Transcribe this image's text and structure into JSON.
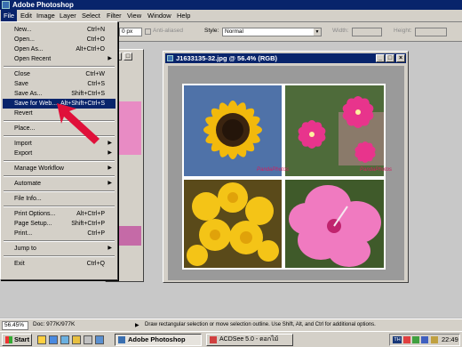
{
  "app": {
    "title": "Adobe Photoshop"
  },
  "menubar": [
    "File",
    "Edit",
    "Image",
    "Layer",
    "Select",
    "Filter",
    "View",
    "Window",
    "Help"
  ],
  "options": {
    "size_value": "0 px",
    "antialiased": "Anti-aliased",
    "style_label": "Style:",
    "style_value": "Normal",
    "width_label": "Width:",
    "height_label": "Height:"
  },
  "file_menu": {
    "groups": [
      [
        {
          "label": "New...",
          "shortcut": "Ctrl+N"
        },
        {
          "label": "Open...",
          "shortcut": "Ctrl+O"
        },
        {
          "label": "Open As...",
          "shortcut": "Alt+Ctrl+O"
        },
        {
          "label": "Open Recent",
          "submenu": true
        }
      ],
      [
        {
          "label": "Close",
          "shortcut": "Ctrl+W"
        },
        {
          "label": "Save",
          "shortcut": "Ctrl+S"
        },
        {
          "label": "Save As...",
          "shortcut": "Shift+Ctrl+S"
        },
        {
          "label": "Save for Web...",
          "shortcut": "Alt+Shift+Ctrl+S",
          "highlighted": true
        },
        {
          "label": "Revert"
        }
      ],
      [
        {
          "label": "Place..."
        }
      ],
      [
        {
          "label": "Import",
          "submenu": true
        },
        {
          "label": "Export",
          "submenu": true
        }
      ],
      [
        {
          "label": "Manage Workflow",
          "submenu": true
        }
      ],
      [
        {
          "label": "Automate",
          "submenu": true
        }
      ],
      [
        {
          "label": "File Info..."
        }
      ],
      [
        {
          "label": "Print Options...",
          "shortcut": "Alt+Ctrl+P"
        },
        {
          "label": "Page Setup...",
          "shortcut": "Shift+Ctrl+P"
        },
        {
          "label": "Print...",
          "shortcut": "Ctrl+P"
        }
      ],
      [
        {
          "label": "Jump to",
          "submenu": true
        }
      ],
      [
        {
          "label": "Exit",
          "shortcut": "Ctrl+Q"
        }
      ]
    ]
  },
  "document": {
    "title": "J1633135-32.jpg @ 56.4% (RGB)",
    "watermark": "PandaPhotos"
  },
  "statusbar": {
    "zoom": "56.45%",
    "doc": "Doc: 977K/977K",
    "hint": "Draw rectangular selection or move selection outline. Use Shift, Alt, and Ctrl for additional options."
  },
  "taskbar": {
    "start": "Start",
    "tasks": [
      {
        "label": "Adobe Photoshop",
        "active": true
      },
      {
        "label": "ACDSee 5.0 - ดอกไม้",
        "active": false
      }
    ],
    "tray_lang": "TH",
    "clock": "22:49"
  },
  "colors": {
    "title_blue": "#08246b",
    "face": "#d4d0c8",
    "arrow_red": "#e0103a"
  }
}
